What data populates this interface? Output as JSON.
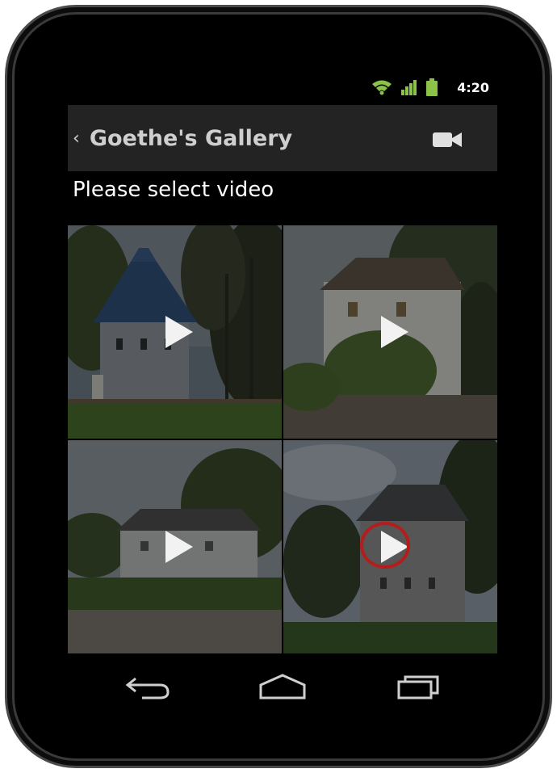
{
  "status_bar": {
    "time": "4:20",
    "icons": [
      "wifi-icon",
      "signal-icon",
      "battery-icon"
    ],
    "accent_color": "#8bc34a"
  },
  "action_bar": {
    "title": "Goethe's Gallery",
    "back_icon": "back-caret-icon",
    "action_icon": "video-camera-icon"
  },
  "content": {
    "prompt": "Please select video",
    "videos": [
      {
        "thumbnail": "gothic-tower-house",
        "icon": "play-icon"
      },
      {
        "thumbnail": "white-house-with-vines",
        "icon": "play-icon"
      },
      {
        "thumbnail": "long-white-house-with-hedge",
        "icon": "play-icon"
      },
      {
        "thumbnail": "tall-house-behind-trees",
        "icon": "play-icon",
        "highlighted": true
      }
    ],
    "highlight_color": "#b51c1c"
  },
  "nav_bar": {
    "buttons": [
      "back-icon",
      "home-icon",
      "recent-apps-icon"
    ]
  }
}
